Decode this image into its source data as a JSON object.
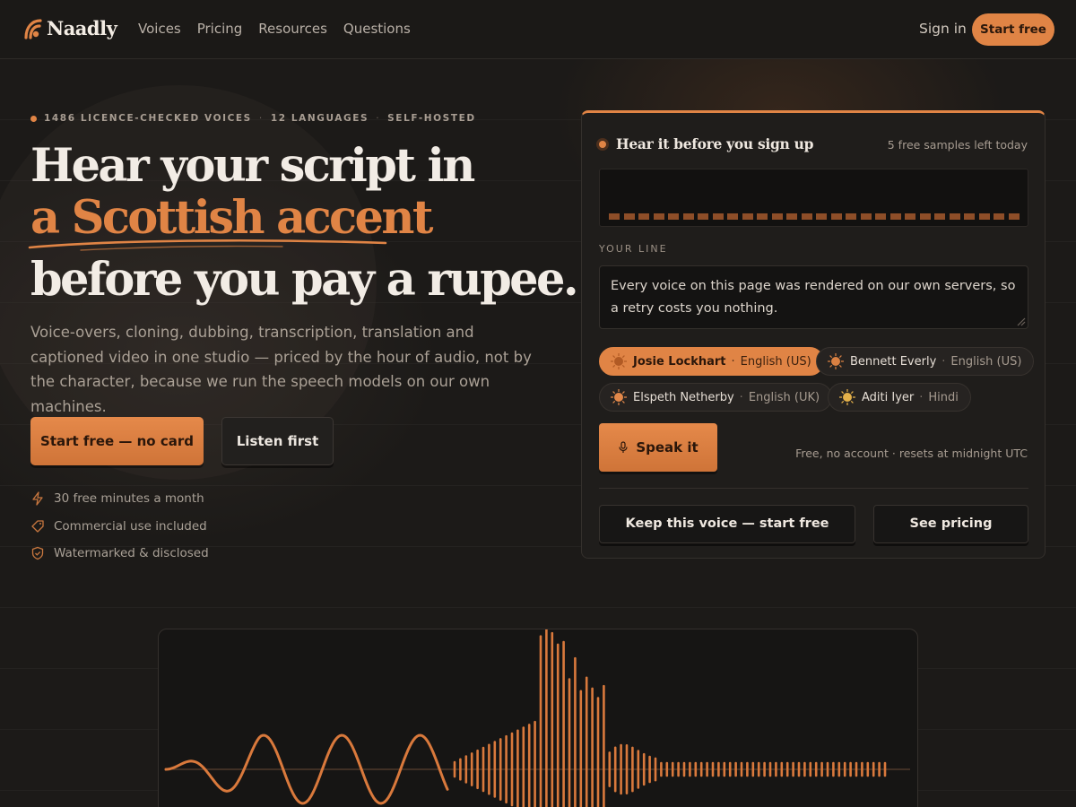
{
  "brand": {
    "name": "Naadly",
    "accent": "#e08445",
    "background": "#1c1a18"
  },
  "nav": {
    "links": [
      "Voices",
      "Pricing",
      "Resources",
      "Questions"
    ],
    "sign_in": "Sign in",
    "cta": "Start free"
  },
  "hero": {
    "eyebrow": [
      "1486 LICENCE-CHECKED VOICES",
      "12 LANGUAGES",
      "SELF-HOSTED"
    ],
    "eyebrow_sep": "·",
    "headline_line1": "Hear your script in",
    "headline_line2": "a Scottish accent",
    "headline_line3": "before you pay a rupee.",
    "lede": "Voice-overs, cloning, dubbing, transcription, translation and captioned video in one studio — priced by the hour of audio, not by the character, because we run the speech models on our own machines.",
    "primary_button": "Start free — no card",
    "secondary_button": "Listen first",
    "perks": [
      {
        "icon": "lightning-icon",
        "text": "30 free minutes a month"
      },
      {
        "icon": "tag-icon",
        "text": "Commercial use included"
      },
      {
        "icon": "shield-icon",
        "text": "Watermarked & disclosed"
      }
    ]
  },
  "demo": {
    "title": "Hear it before you sign up",
    "samples_left": "5 free samples left today",
    "your_line_label": "YOUR LINE",
    "line_text": "Every voice on this page was rendered on our own servers, so a retry costs you nothing.",
    "voices": [
      {
        "name": "Josie Lockhart",
        "lang": "English (US)",
        "selected": true
      },
      {
        "name": "Bennett Everly",
        "lang": "English (US)",
        "selected": false
      },
      {
        "name": "Elspeth Netherby",
        "lang": "English (UK)",
        "selected": false
      },
      {
        "name": "Aditi Iyer",
        "lang": "Hindi",
        "selected": false
      }
    ],
    "chip_sep": "·",
    "speak_button": "Speak it",
    "speak_note": "Free, no account · resets at midnight UTC",
    "keep_button": "Keep this voice — start free",
    "pricing_button": "See pricing"
  }
}
